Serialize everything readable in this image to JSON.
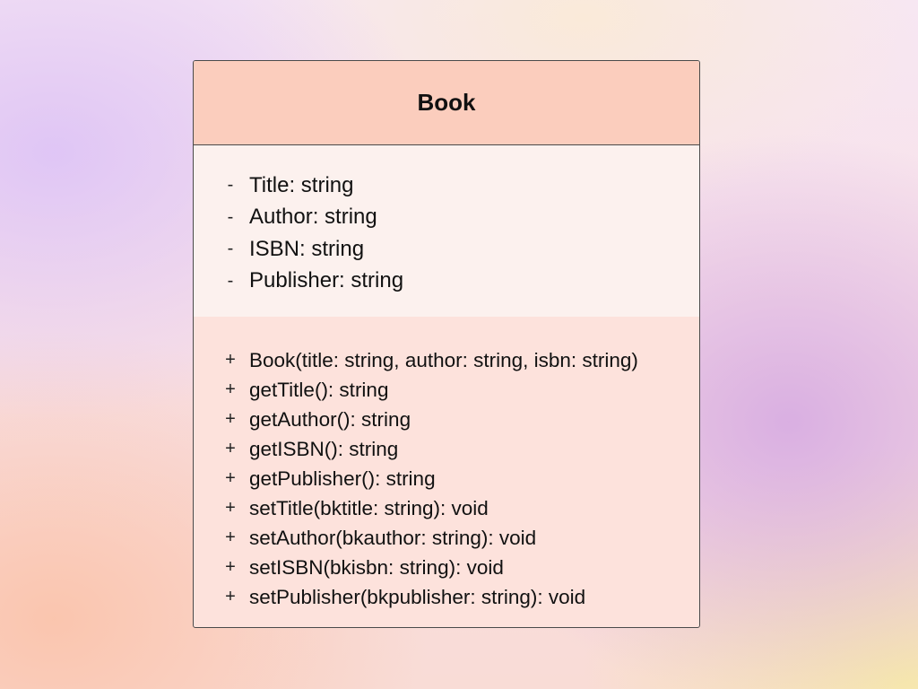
{
  "class": {
    "name": "Book",
    "attributes": [
      {
        "visibility": "-",
        "text": "Title: string"
      },
      {
        "visibility": "-",
        "text": "Author: string"
      },
      {
        "visibility": "-",
        "text": "ISBN: string"
      },
      {
        "visibility": "-",
        "text": "Publisher: string"
      }
    ],
    "methods": [
      {
        "visibility": "+",
        "text": "Book(title: string, author: string, isbn: string)"
      },
      {
        "visibility": "+",
        "text": "getTitle(): string"
      },
      {
        "visibility": "+",
        "text": "getAuthor(): string"
      },
      {
        "visibility": "+",
        "text": "getISBN(): string"
      },
      {
        "visibility": "+",
        "text": "getPublisher(): string"
      },
      {
        "visibility": "+",
        "text": "setTitle(bktitle: string): void"
      },
      {
        "visibility": "+",
        "text": "setAuthor(bkauthor: string): void"
      },
      {
        "visibility": "+",
        "text": "setISBN(bkisbn: string): void"
      },
      {
        "visibility": "+",
        "text": "setPublisher(bkpublisher: string): void"
      }
    ]
  },
  "colors": {
    "header": "#fbcdbd",
    "attributes_bg": "#fcf1ee",
    "methods_bg": "#fde2dc",
    "border": "#4a4a4a"
  }
}
